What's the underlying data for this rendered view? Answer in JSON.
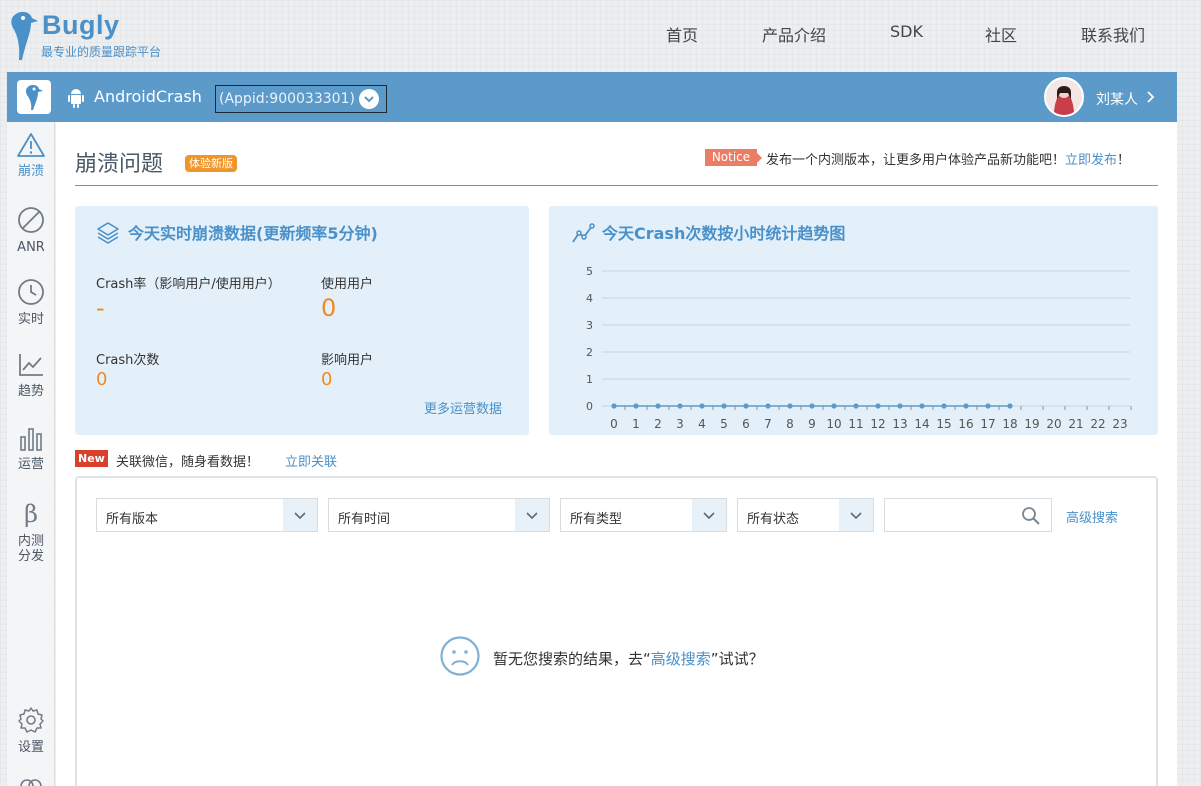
{
  "brand": {
    "name": "Bugly",
    "tagline": "最专业的质量跟踪平台"
  },
  "topnav": {
    "items": [
      "首页",
      "产品介绍",
      "SDK",
      "社区",
      "联系我们"
    ]
  },
  "appbar": {
    "app_name": "AndroidCrash",
    "appid": "(Appid:900033301)",
    "user_name": "刘某人"
  },
  "sidebar": {
    "items": [
      {
        "label": "崩溃",
        "icon": "warning-icon",
        "active": true
      },
      {
        "label": "ANR",
        "icon": "no-entry-icon",
        "active": false
      },
      {
        "label": "实时",
        "icon": "clock-icon",
        "active": false
      },
      {
        "label": "趋势",
        "icon": "trend-chart-icon",
        "active": false
      },
      {
        "label": "运营",
        "icon": "bar-chart-icon",
        "active": false
      },
      {
        "label": "内测",
        "label2": "分发",
        "icon": "beta-icon",
        "active": false
      },
      {
        "label": "设置",
        "icon": "gear-icon",
        "active": false
      }
    ]
  },
  "page": {
    "title": "崩溃问题",
    "badge": "体验新版",
    "notice_tag": "Notice",
    "notice_text": "发布一个内测版本，让更多用户体验产品新功能吧！",
    "notice_link": "立即发布",
    "notice_end": "！"
  },
  "realtime_card": {
    "title": "今天实时崩溃数据(更新频率5分钟)",
    "crash_rate_label": "Crash率（影响用户/使用用户）",
    "crash_rate_value": "-",
    "active_users_label": "使用用户",
    "active_users_value": "0",
    "crash_count_label": "Crash次数",
    "crash_count_value": "0",
    "affected_users_label": "影响用户",
    "affected_users_value": "0",
    "more_link": "更多运营数据"
  },
  "trend_card": {
    "title": "今天Crash次数按小时统计趋势图"
  },
  "chart_data": {
    "type": "line",
    "title": "今天Crash次数按小时统计趋势图",
    "xlabel": "",
    "ylabel": "",
    "x": [
      "0",
      "1",
      "2",
      "3",
      "4",
      "5",
      "6",
      "7",
      "8",
      "9",
      "10",
      "11",
      "12",
      "13",
      "14",
      "15",
      "16",
      "17",
      "18",
      "19",
      "20",
      "21",
      "22",
      "23"
    ],
    "y_ticks": [
      "0",
      "1",
      "2",
      "3",
      "4",
      "5"
    ],
    "ylim": [
      0,
      5
    ],
    "grid": true,
    "series": [
      {
        "values": [
          0,
          0,
          0,
          0,
          0,
          0,
          0,
          0,
          0,
          0,
          0,
          0,
          0,
          0,
          0,
          0,
          0,
          0,
          0
        ],
        "color": "#5b9ac9"
      }
    ]
  },
  "wechat": {
    "badge": "New",
    "text": "关联微信，随身看数据！",
    "link": "立即关联"
  },
  "filters": {
    "version": "所有版本",
    "time": "所有时间",
    "type": "所有类型",
    "status": "所有状态",
    "search_placeholder": "",
    "advanced": "高级搜索"
  },
  "empty": {
    "text_before": "暂无您搜索的结果，去“",
    "link": "高级搜索",
    "text_after": "”试试？"
  },
  "colors": {
    "accent": "#5b9ac9",
    "link": "#4a90c9",
    "value_orange": "#f08a24",
    "card_bg": "#e4f0f9"
  }
}
